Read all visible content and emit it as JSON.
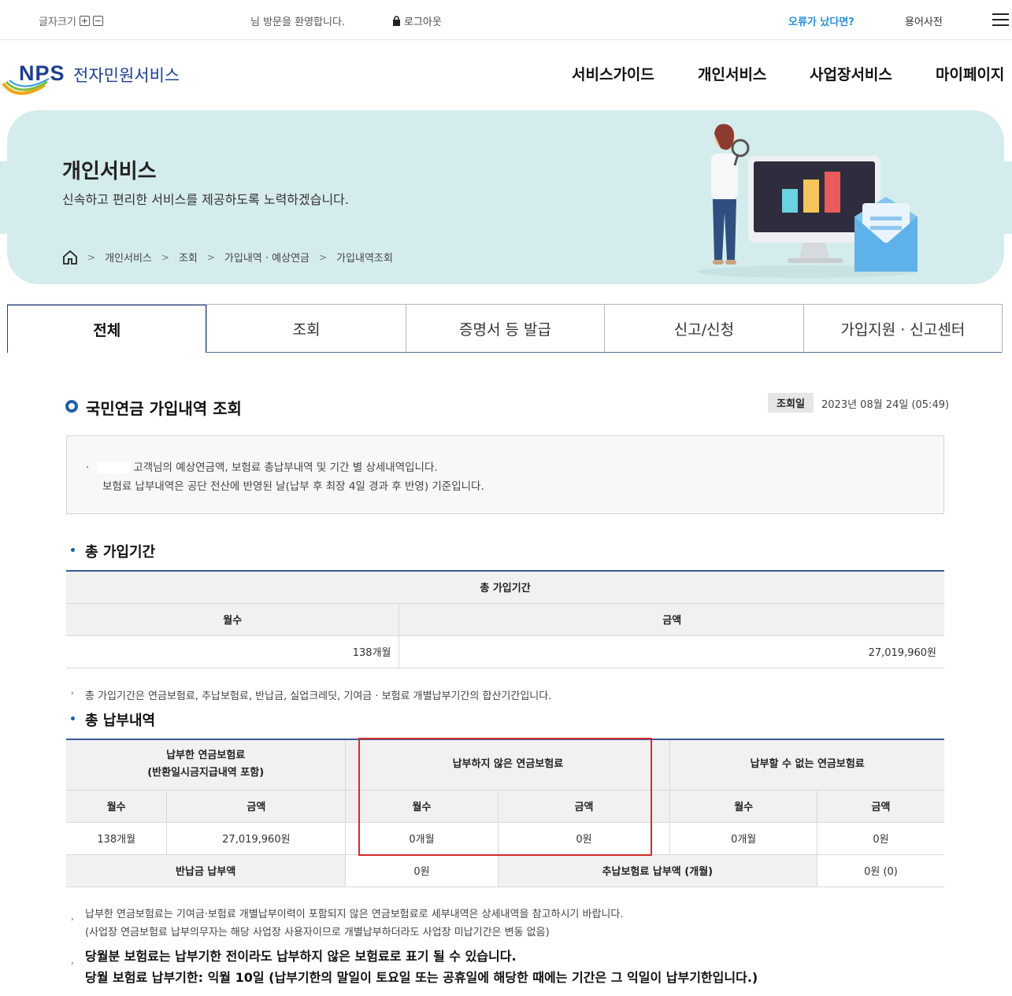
{
  "utility": {
    "font_size_label": "글자크기",
    "font_plus": "+",
    "font_minus": "−",
    "welcome": "님 방문을 환영합니다.",
    "logout": "로그아웃",
    "error_link": "오류가 났다면?",
    "dictionary": "용어사전"
  },
  "header": {
    "logo_mark": "NPS",
    "logo_text": "전자민원서비스",
    "nav": [
      "서비스가이드",
      "개인서비스",
      "사업장서비스",
      "마이페이지"
    ]
  },
  "banner": {
    "title": "개인서비스",
    "subtitle": "신속하고 편리한 서비스를 제공하도록 노력하겠습니다.",
    "breadcrumb": [
      "개인서비스",
      "조회",
      "가입내역 · 예상연금",
      "가입내역조회"
    ]
  },
  "tabs": [
    "전체",
    "조회",
    "증명서 등 발급",
    "신고/신청",
    "가입지원 · 신고센터"
  ],
  "page": {
    "title": "국민연금 가입내역 조회",
    "date_label": "조회일",
    "date_value": "2023년 08월 24일 (05:49)",
    "info_line1": "고객님의 예상연금액, 보험료 총납부내역 및 기간 별 상세내역입니다.",
    "info_line2": "보험료 납부내역은 공단 전산에 반영된 날(납부 후 최장 4일 경과 후 반영) 기준입니다."
  },
  "total_period": {
    "heading": "총 가입기간",
    "table_title": "총 가입기간",
    "col_months": "월수",
    "col_amount": "금액",
    "months": "138개월",
    "amount": "27,019,960원",
    "note": "총 가입기간은 연금보험료, 추납보험료, 반납금, 실업크레딧, 기여금 · 보험료 개별납부기간의 합산기간입니다."
  },
  "total_payment": {
    "heading": "총 납부내역",
    "group_paid_line1": "납부한 연금보험료",
    "group_paid_line2": "(반환일시금지급내역 포함)",
    "group_unpaid": "납부하지 않은 연금보험료",
    "group_unpayable": "납부할 수 없는 연금보험료",
    "col_months": "월수",
    "col_amount": "금액",
    "paid_months": "138개월",
    "paid_amount": "27,019,960원",
    "unpaid_months": "0개월",
    "unpaid_amount": "0원",
    "unpayable_months": "0개월",
    "unpayable_amount": "0원",
    "refund_label": "반납금 납부액",
    "refund_value": "0원",
    "extra_label": "추납보험료 납부액 (개월)",
    "extra_value": "0원 (0)"
  },
  "notes": {
    "note1": "납부한 연금보험료는 기여금·보험료 개별납부이력이 포함되지 않은 연금보험료로 세부내역은 상세내역을 참고하시기 바랍니다.",
    "note2": "(사업장 연금보험료 납부의무자는 해당 사업장 사용자이므로 개별납부하더라도 사업장 미납기간은 변동 없음)",
    "big1": "당월분 보험료는 납부기한 전이라도 납부하지 않은 보험료로 표기 될 수 있습니다.",
    "big2": "당월 보험료 납부기한: 익월 10일 (납부기한의 말일이 토요일 또는 공휴일에 해당한 때에는 기간은 그 익일이 납부기한입니다.)"
  },
  "colors": {
    "brand_navy": "#1d3f8f",
    "banner_bg": "#d5eced",
    "error_link": "#2b8fd6",
    "highlight_red": "#d62b2b"
  }
}
